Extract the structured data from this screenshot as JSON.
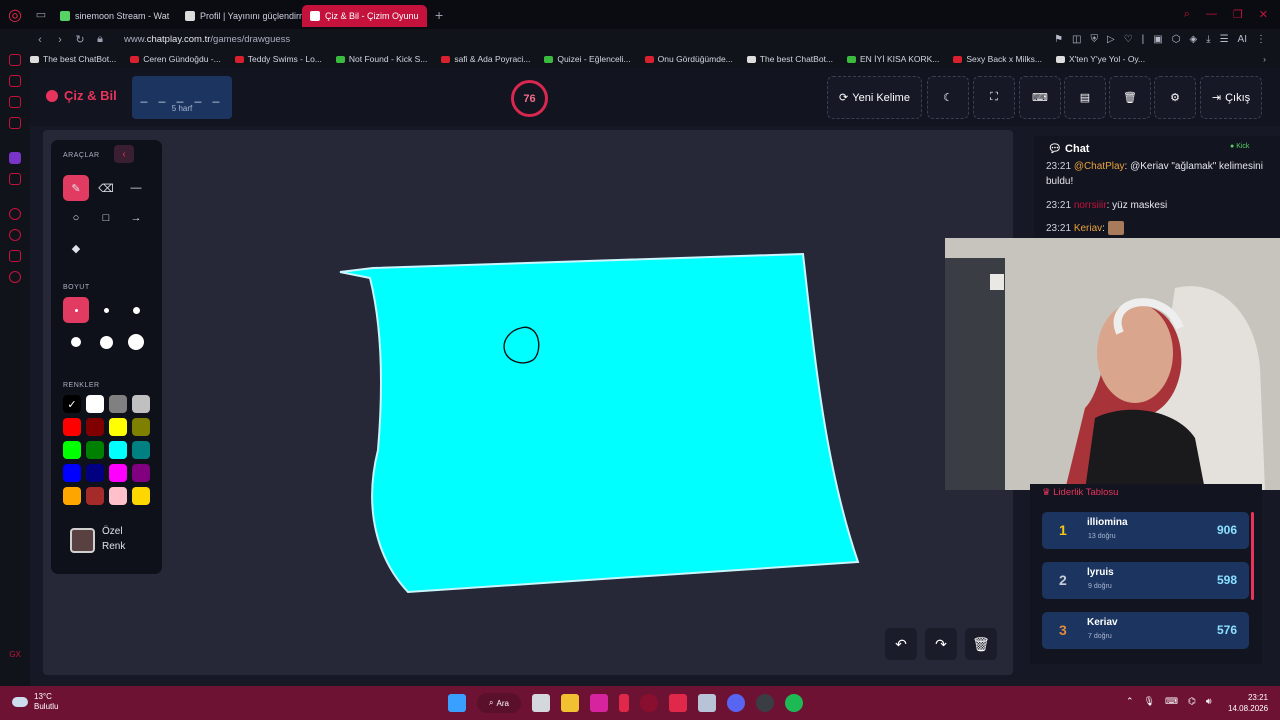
{
  "browser": {
    "tabs": [
      {
        "label": "sinemoon Stream - Wat",
        "fav": "#56d364",
        "active": false
      },
      {
        "label": "Profil | Yayınını güçlendirme",
        "fav": "#dddddd",
        "active": false
      },
      {
        "label": "Çiz & Bil - Çizim Oyunu",
        "fav": "#ffffff",
        "active": true
      }
    ],
    "url_prefix": "www.",
    "url_host": "chatplay.com.tr",
    "url_path": "/games/drawguess",
    "ai_label": "AI",
    "bookmarks": [
      {
        "label": "The best ChatBot...",
        "icon": "w"
      },
      {
        "label": "Ceren Gündoğdu -...",
        "icon": "r"
      },
      {
        "label": "Teddy Swims - Lo...",
        "icon": "r"
      },
      {
        "label": "Not Found - Kick S...",
        "icon": "g"
      },
      {
        "label": "safi & Ada Poyraci...",
        "icon": "r"
      },
      {
        "label": "Quizei - Eğlenceli...",
        "icon": "g"
      },
      {
        "label": "Onu Gördüğümde...",
        "icon": "r"
      },
      {
        "label": "The best ChatBot...",
        "icon": "w"
      },
      {
        "label": "EN İYİ KISA KORK...",
        "icon": "g"
      },
      {
        "label": "Sexy Back x Milks...",
        "icon": "r"
      },
      {
        "label": "X'ten Y'ye Yol - Oy...",
        "icon": "w"
      }
    ],
    "gx_label": "GX"
  },
  "app": {
    "logo": "Çiz & Bil",
    "word_dashes": "_ _ _ _ _",
    "word_length": "5 harf",
    "timer": "76",
    "buttons": {
      "new_word": "Yeni Kelime",
      "exit": "Çıkış"
    }
  },
  "tools": {
    "section_tools": "ARAÇLAR",
    "section_size": "BOYUT",
    "section_colors": "RENKLER",
    "custom_color_l1": "Özel",
    "custom_color_l2": "Renk",
    "colors": [
      "#000000",
      "#ffffff",
      "#808080",
      "#c0c0c0",
      "#ff0000",
      "#800000",
      "#ffff00",
      "#808000",
      "#00ff00",
      "#008000",
      "#00ffff",
      "#008080",
      "#0000ff",
      "#000080",
      "#ff00ff",
      "#800080",
      "#ffa500",
      "#a52a2a",
      "#ffc0cb",
      "#ffd700"
    ],
    "selected_color": "#000000"
  },
  "chat": {
    "title": "Chat",
    "platform": "Kick",
    "messages": [
      {
        "time": "23:21",
        "user": "@ChatPlay",
        "user_color": "#e9a13b",
        "text": ": @Keriav \"ağlamak\" kelimesini buldu!"
      },
      {
        "time": "23:21",
        "user": "norrsiiir",
        "user_color": "#c5123d",
        "text": ": yüz maskesi"
      },
      {
        "time": "23:21",
        "user": "Keriav",
        "user_color": "#e9a13b",
        "text": ":"
      }
    ]
  },
  "leaderboard": {
    "title": "Liderlik Tablosu",
    "rows": [
      {
        "rank": "1",
        "name": "illiomina",
        "sub": "13 doğru",
        "score": "906",
        "rank_color": "#f5c518"
      },
      {
        "rank": "2",
        "name": "lyruis",
        "sub": "9 doğru",
        "score": "598",
        "rank_color": "#c8ccd6"
      },
      {
        "rank": "3",
        "name": "Keriav",
        "sub": "7 doğru",
        "score": "576",
        "rank_color": "#e08a3a"
      }
    ]
  },
  "taskbar": {
    "temp": "13°C",
    "weather": "Bulutlu",
    "search": "Ara",
    "time": "23:21",
    "date": "14.08.2026"
  }
}
